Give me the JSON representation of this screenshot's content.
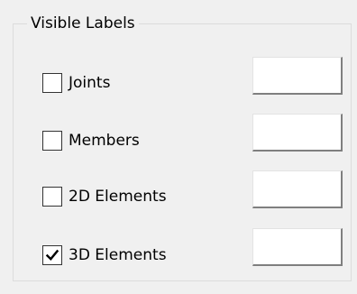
{
  "group": {
    "title": "Visible Labels"
  },
  "items": [
    {
      "label": "Joints",
      "checked": false
    },
    {
      "label": "Members",
      "checked": false
    },
    {
      "label": "2D Elements",
      "checked": false
    },
    {
      "label": "3D Elements",
      "checked": true
    }
  ],
  "colors": {
    "background": "#f0f0f0",
    "button_fill": "#ffffff"
  }
}
